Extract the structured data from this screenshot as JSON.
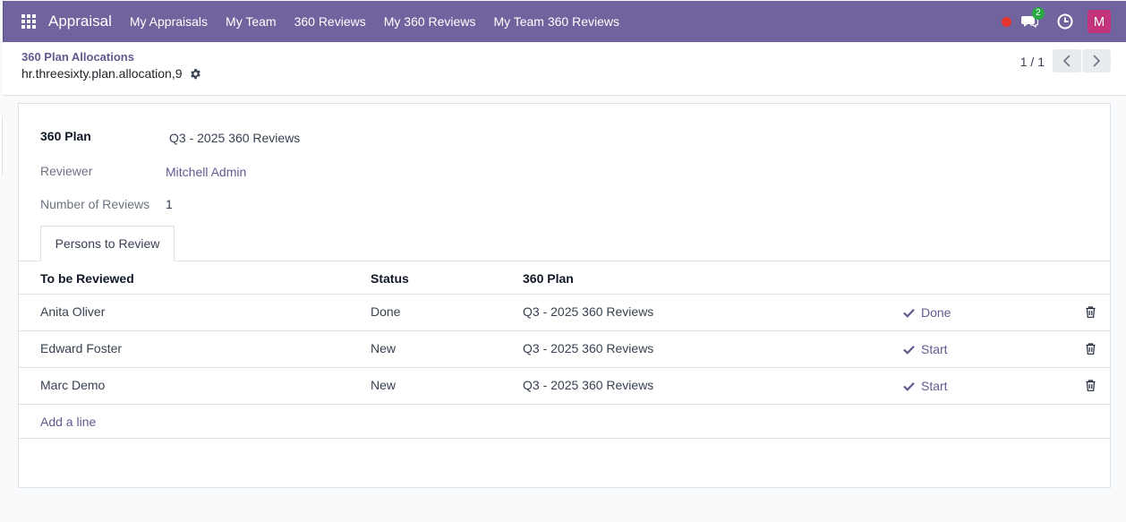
{
  "navbar": {
    "brand": "Appraisal",
    "items": [
      "My Appraisals",
      "My Team",
      "360 Reviews",
      "My 360 Reviews",
      "My Team 360 Reviews"
    ],
    "chat_badge": "2",
    "avatar": "M",
    "color": "#71639e"
  },
  "control": {
    "breadcrumb_parent": "360 Plan Allocations",
    "breadcrumb_current": "hr.threesixty.plan.allocation,9",
    "pager": "1 / 1"
  },
  "form": {
    "plan_label": "360 Plan",
    "plan_value": "Q3 - 2025 360 Reviews",
    "reviewer_label": "Reviewer",
    "reviewer_value": "Mitchell Admin",
    "count_label": "Number of Reviews",
    "count_value": "1"
  },
  "tab": {
    "label": "Persons to Review"
  },
  "table": {
    "headers": [
      "To be Reviewed",
      "Status",
      "360 Plan"
    ],
    "rows": [
      {
        "name": "Anita Oliver",
        "status": "Done",
        "plan": "Q3 - 2025 360 Reviews",
        "action": "Done"
      },
      {
        "name": "Edward Foster",
        "status": "New",
        "plan": "Q3 - 2025 360 Reviews",
        "action": "Start"
      },
      {
        "name": "Marc Demo",
        "status": "New",
        "plan": "Q3 - 2025 360 Reviews",
        "action": "Start"
      }
    ],
    "add_line": "Add a line"
  }
}
